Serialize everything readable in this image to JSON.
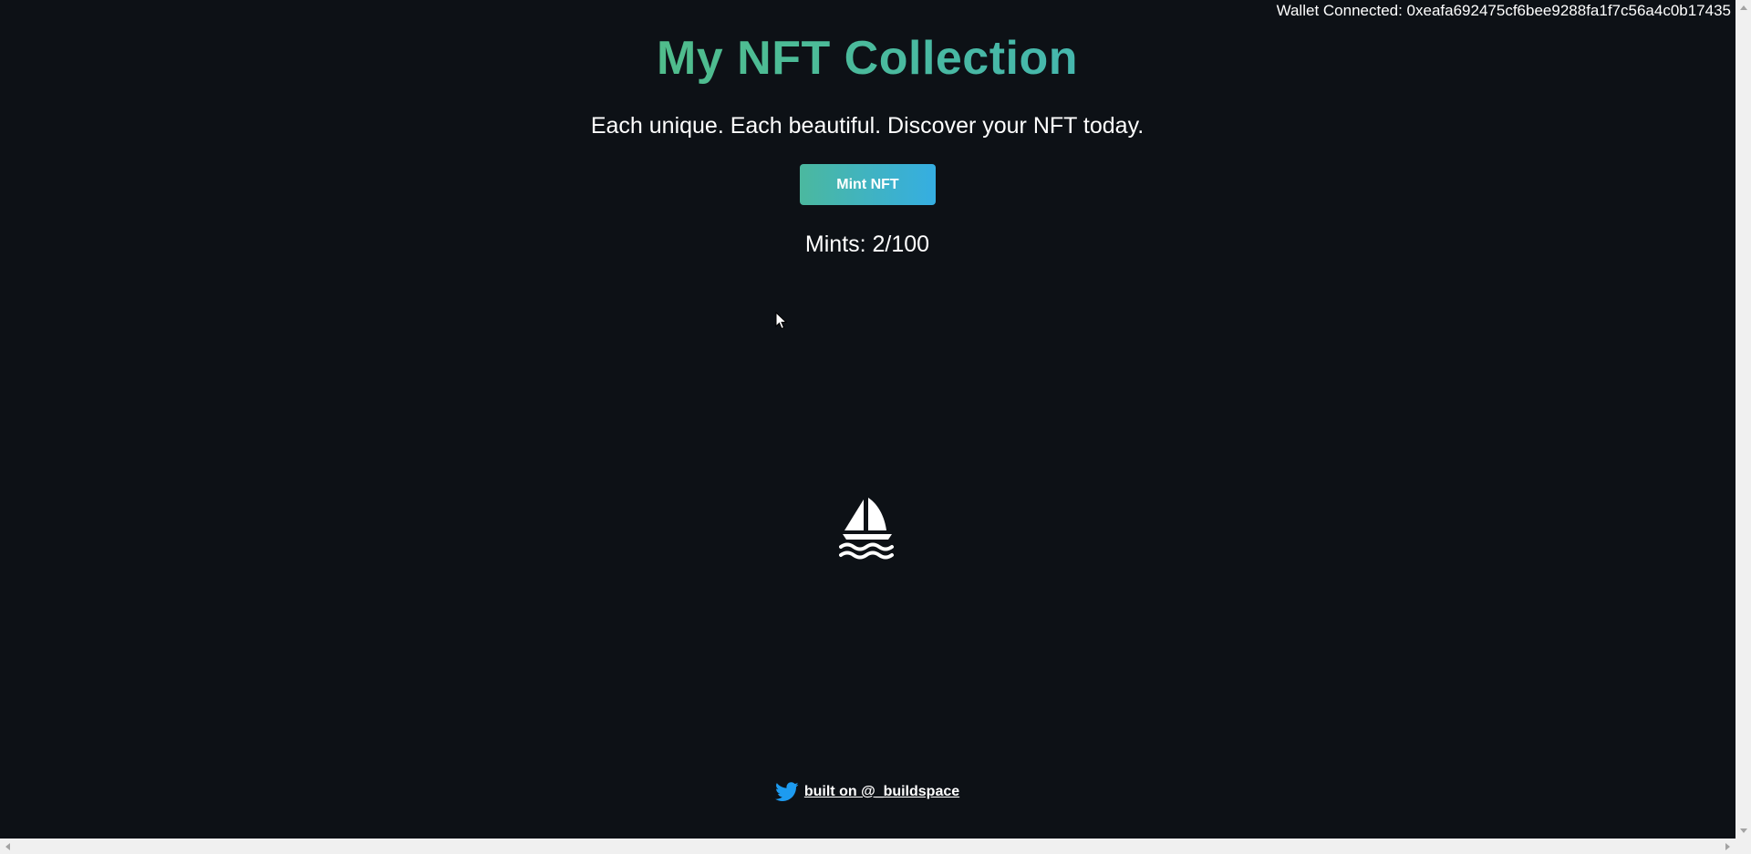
{
  "wallet": {
    "label": "Wallet Connected: 0xeafa692475cf6bee9288fa1f7c56a4c0b17435"
  },
  "header": {
    "title": "My NFT Collection",
    "subtitle": "Each unique. Each beautiful. Discover your NFT today."
  },
  "mint": {
    "button_label": "Mint NFT",
    "count_text": "Mints: 2/100"
  },
  "footer": {
    "link_text": "built on @_buildspace"
  },
  "colors": {
    "background": "#0d1116",
    "gradient_start": "#60c657",
    "gradient_end": "#35aee2",
    "twitter_blue": "#1d9bf0"
  },
  "icons": {
    "opensea": "sailboat-icon",
    "twitter": "twitter-icon",
    "cursor": "cursor-icon"
  }
}
